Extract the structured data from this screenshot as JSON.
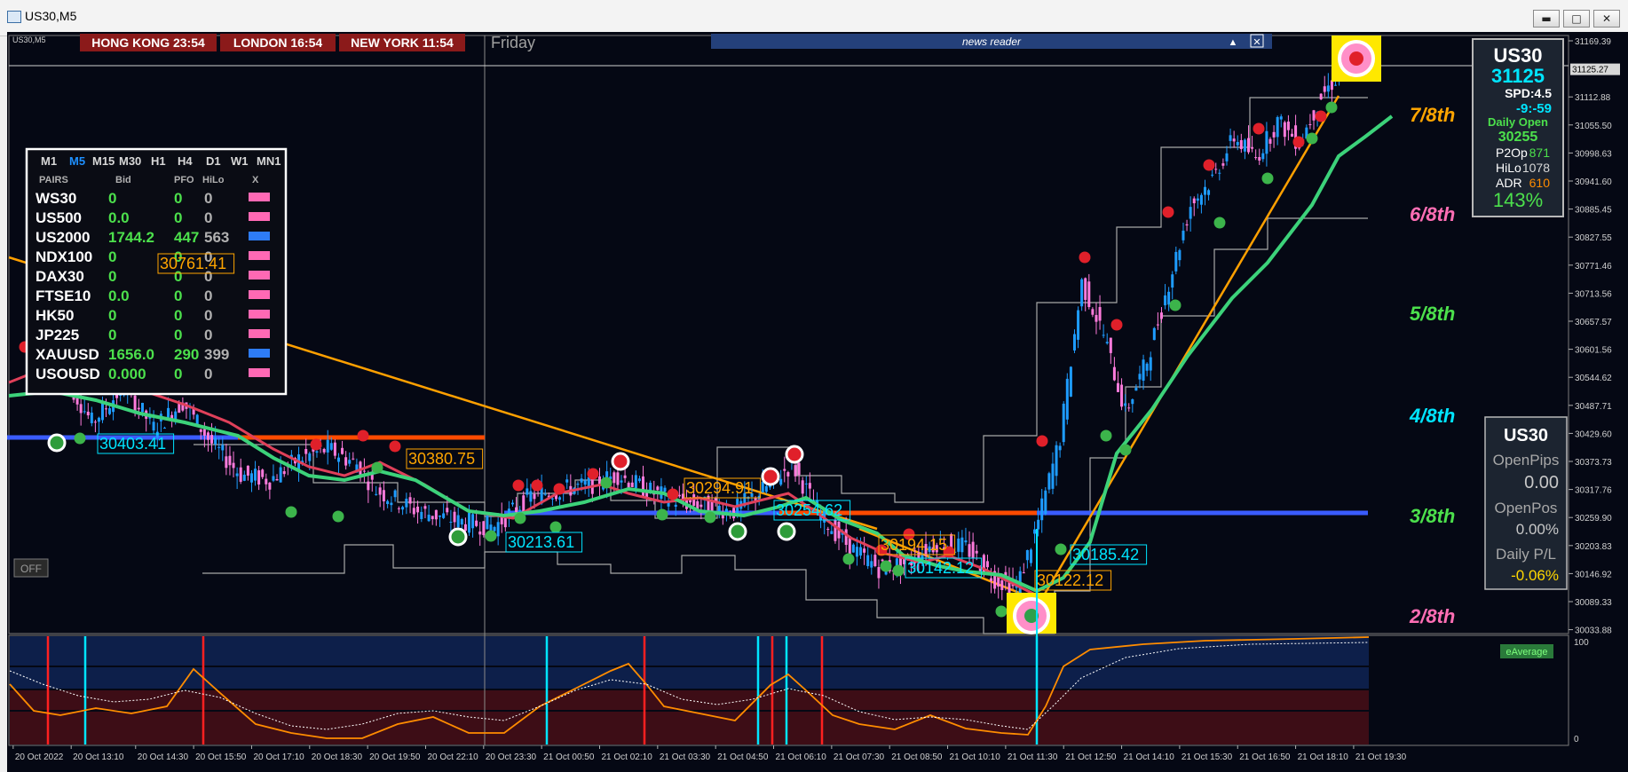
{
  "window": {
    "title": "US30,M5",
    "min_glyph": "▬",
    "max_glyph": "□",
    "close_glyph": "✕"
  },
  "chart_caption": "US30,M5",
  "clocks": [
    {
      "label": "HONG KONG 23:54"
    },
    {
      "label": "LONDON 16:54"
    },
    {
      "label": "NEW YORK 11:54"
    }
  ],
  "day_label": "Friday",
  "news_reader": {
    "label": "news reader",
    "collapse_glyph": "▲",
    "close_glyph": "✕"
  },
  "off_button": "OFF",
  "pairs_panel": {
    "timeframes": [
      "M1",
      "M5",
      "M15",
      "M30",
      "H1",
      "H4",
      "D1",
      "W1",
      "MN1"
    ],
    "active_timeframe": "M5",
    "headers": [
      "PAIRS",
      "Bid",
      "PFO",
      "HiLo",
      "X"
    ],
    "rows": [
      {
        "pair": "WS30",
        "bid": "0",
        "pfo": "0",
        "hilo": "0",
        "x_color": "#ff69b4"
      },
      {
        "pair": "US500",
        "bid": "0.0",
        "pfo": "0",
        "hilo": "0",
        "x_color": "#ff69b4"
      },
      {
        "pair": "US2000",
        "bid": "1744.2",
        "pfo": "447",
        "hilo": "563",
        "x_color": "#2e7cf6"
      },
      {
        "pair": "NDX100",
        "bid": "0",
        "pfo": "0",
        "hilo": "0",
        "x_color": "#ff69b4"
      },
      {
        "pair": "DAX30",
        "bid": "0",
        "pfo": "0",
        "hilo": "0",
        "x_color": "#ff69b4"
      },
      {
        "pair": "FTSE10",
        "bid": "0.0",
        "pfo": "0",
        "hilo": "0",
        "x_color": "#ff69b4"
      },
      {
        "pair": "HK50",
        "bid": "0",
        "pfo": "0",
        "hilo": "0",
        "x_color": "#ff69b4"
      },
      {
        "pair": "JP225",
        "bid": "0",
        "pfo": "0",
        "hilo": "0",
        "x_color": "#ff69b4"
      },
      {
        "pair": "XAUUSD",
        "bid": "1656.0",
        "pfo": "290",
        "hilo": "399",
        "x_color": "#2e7cf6"
      },
      {
        "pair": "USOUSD",
        "bid": "0.000",
        "pfo": "0",
        "hilo": "0",
        "x_color": "#ff69b4"
      }
    ]
  },
  "price_labels": [
    {
      "text": "30403.41",
      "color": "#00e5ff"
    },
    {
      "text": "30380.75",
      "color": "#ffa500"
    },
    {
      "text": "30761.41",
      "color": "#ffa500"
    },
    {
      "text": "30213.61",
      "color": "#00e5ff"
    },
    {
      "text": "30294.91",
      "color": "#ffa500"
    },
    {
      "text": "30254.62",
      "color": "#00e5ff"
    },
    {
      "text": "30194.15",
      "color": "#ffa500"
    },
    {
      "text": "30142.12",
      "color": "#00e5ff"
    },
    {
      "text": "30185.42",
      "color": "#00e5ff"
    },
    {
      "text": "30122.12",
      "color": "#ffa500"
    }
  ],
  "murrey": [
    {
      "label": "7/8th",
      "color": "#ffa500"
    },
    {
      "label": "6/8th",
      "color": "#ff6eb4"
    },
    {
      "label": "5/8th",
      "color": "#4ce04c"
    },
    {
      "label": "4/8th",
      "color": "#00e5ff"
    },
    {
      "label": "3/8th",
      "color": "#4ce04c"
    },
    {
      "label": "2/8th",
      "color": "#ff6eb4"
    }
  ],
  "info_panel": {
    "symbol": "US30",
    "price": "31125",
    "spread": "SPD:4.5",
    "change": "-9:-59",
    "daily_open_label": "Daily Open",
    "daily_open_value": "30255",
    "stats": [
      {
        "label": "P2Op",
        "value": "871",
        "color": "#4ce04c"
      },
      {
        "label": "HiLo",
        "value": "1078",
        "color": "#d8d8d8"
      },
      {
        "label": "ADR",
        "value": "610",
        "color": "#ff8c00"
      }
    ],
    "percent": "143%"
  },
  "pl_panel": {
    "symbol": "US30",
    "open_pips_label": "OpenPips",
    "open_pips_value": "0.00",
    "open_pos_label": "OpenPos",
    "open_pos_value": "0.00%",
    "daily_pl_label": "Daily P/L",
    "daily_pl_value": "-0.06%"
  },
  "price_axis": {
    "ticks": [
      "31169.39",
      "31125.27",
      "31112.88",
      "31055.50",
      "30998.63",
      "30941.60",
      "30885.45",
      "30827.55",
      "30771.46",
      "30713.56",
      "30657.57",
      "30601.56",
      "30544.62",
      "30487.71",
      "30429.60",
      "30373.73",
      "30317.76",
      "30259.90",
      "30203.83",
      "30146.92",
      "30089.33",
      "30033.88"
    ],
    "current": "31125.27"
  },
  "oscillator": {
    "label": "eAverage",
    "scale_max": "100",
    "scale_min": "0"
  },
  "time_axis": [
    "20 Oct 2022",
    "20 Oct 13:10",
    "20 Oct 14:30",
    "20 Oct 15:50",
    "20 Oct 17:10",
    "20 Oct 18:30",
    "20 Oct 19:50",
    "20 Oct 22:10",
    "20 Oct 23:30",
    "21 Oct 00:50",
    "21 Oct 02:10",
    "21 Oct 03:30",
    "21 Oct 04:50",
    "21 Oct 06:10",
    "21 Oct 07:30",
    "21 Oct 08:50",
    "21 Oct 10:10",
    "21 Oct 11:30",
    "21 Oct 12:50",
    "21 Oct 14:10",
    "21 Oct 15:30",
    "21 Oct 16:50",
    "21 Oct 18:10",
    "21 Oct 19:30"
  ],
  "price_path": [
    [
      "20 Oct 13:00",
      30540
    ],
    [
      "20 Oct 13:40",
      30430
    ],
    [
      "20 Oct 14:20",
      30500
    ],
    [
      "20 Oct 15:00",
      30420
    ],
    [
      "20 Oct 15:40",
      30470
    ],
    [
      "20 Oct 16:20",
      30390
    ],
    [
      "20 Oct 17:00",
      30330
    ],
    [
      "20 Oct 17:40",
      30320
    ],
    [
      "20 Oct 18:20",
      30360
    ],
    [
      "20 Oct 19:00",
      30380
    ],
    [
      "20 Oct 19:40",
      30350
    ],
    [
      "20 Oct 20:20",
      30300
    ],
    [
      "20 Oct 22:00",
      30260
    ],
    [
      "20 Oct 23:00",
      30240
    ],
    [
      "20 Oct 23:50",
      30230
    ],
    [
      "21 Oct 00:40",
      30290
    ],
    [
      "21 Oct 01:20",
      30300
    ],
    [
      "21 Oct 02:00",
      30310
    ],
    [
      "21 Oct 02:40",
      30330
    ],
    [
      "21 Oct 03:20",
      30300
    ],
    [
      "21 Oct 04:00",
      30280
    ],
    [
      "21 Oct 04:40",
      30270
    ],
    [
      "21 Oct 05:20",
      30260
    ],
    [
      "21 Oct 06:00",
      30300
    ],
    [
      "21 Oct 06:40",
      30350
    ],
    [
      "21 Oct 07:20",
      30250
    ],
    [
      "21 Oct 08:00",
      30190
    ],
    [
      "21 Oct 08:40",
      30150
    ],
    [
      "21 Oct 09:20",
      30160
    ],
    [
      "21 Oct 10:00",
      30200
    ],
    [
      "21 Oct 10:40",
      30190
    ],
    [
      "21 Oct 11:20",
      30130
    ],
    [
      "21 Oct 11:50",
      30110
    ],
    [
      "21 Oct 12:20",
      30240
    ],
    [
      "21 Oct 12:50",
      30400
    ],
    [
      "21 Oct 13:20",
      30700
    ],
    [
      "21 Oct 13:50",
      30600
    ],
    [
      "21 Oct 14:20",
      30450
    ],
    [
      "21 Oct 14:50",
      30550
    ],
    [
      "21 Oct 15:20",
      30700
    ],
    [
      "21 Oct 15:50",
      30850
    ],
    [
      "21 Oct 16:20",
      30900
    ],
    [
      "21 Oct 16:50",
      30980
    ],
    [
      "21 Oct 17:20",
      30940
    ],
    [
      "21 Oct 17:50",
      31010
    ],
    [
      "21 Oct 18:20",
      30970
    ],
    [
      "21 Oct 18:50",
      31060
    ],
    [
      "21 Oct 19:20",
      31110
    ],
    [
      "21 Oct 19:50",
      31125
    ]
  ],
  "colors": {
    "bg": "#050814",
    "grid": "#4a4a4a",
    "bull": "#1e9cff",
    "bear": "#ff7bdc",
    "ma_green": "#3cd27a",
    "ma_red": "#e0405a",
    "trend_orange": "#ffa000",
    "blue_line": "#3a5cff",
    "red_line": "#ff4a00"
  }
}
